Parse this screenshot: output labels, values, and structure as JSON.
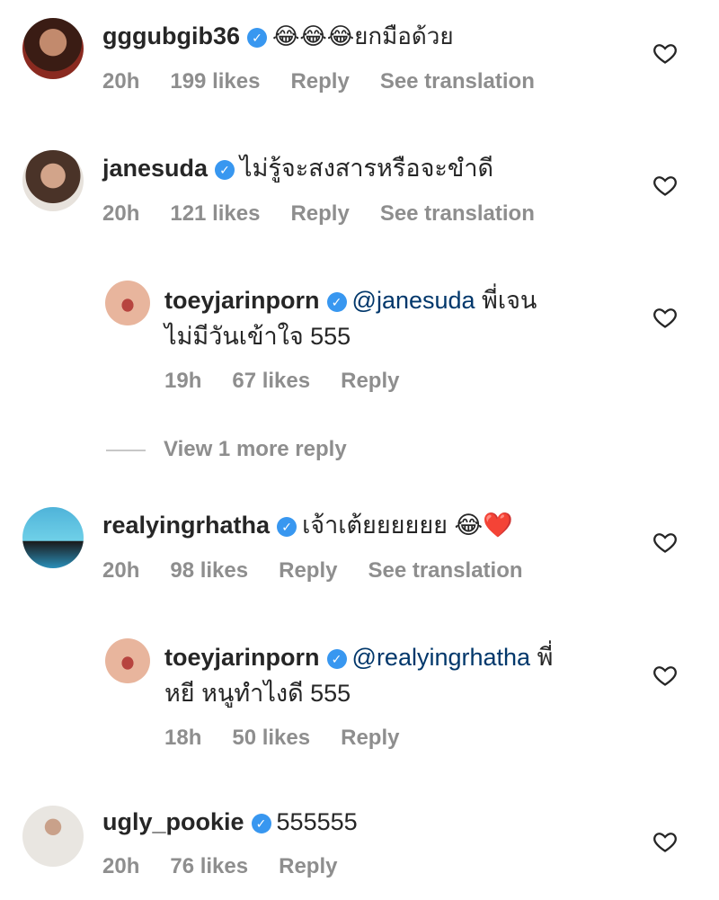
{
  "comments": [
    {
      "username": "gggubgib36",
      "text": "😂😂😂ยกมือด้วย",
      "time": "20h",
      "likes": "199 likes",
      "reply": "Reply",
      "translate": "See translation"
    },
    {
      "username": "janesuda",
      "text": "ไม่รู้จะสงสารหรือจะขำดี",
      "time": "20h",
      "likes": "121 likes",
      "reply": "Reply",
      "translate": "See translation"
    },
    {
      "username": "toeyjarinporn",
      "mention": "@janesuda",
      "text_line1": " พี่เจน",
      "text_line2": "ไม่มีวันเข้าใจ 555",
      "time": "19h",
      "likes": "67 likes",
      "reply": "Reply"
    },
    {
      "username": "realyingrhatha",
      "text": "เจ้าเต้ยยยยยย 😂❤️",
      "time": "20h",
      "likes": "98 likes",
      "reply": "Reply",
      "translate": "See translation"
    },
    {
      "username": "toeyjarinporn",
      "mention": "@realyingrhatha",
      "text_line1": " พี่",
      "text_line2": "หยี หนูทำไงดี 555",
      "time": "18h",
      "likes": "50 likes",
      "reply": "Reply"
    },
    {
      "username": "ugly_pookie",
      "text": "555555",
      "time": "20h",
      "likes": "76 likes",
      "reply": "Reply"
    }
  ],
  "view_more": "View 1 more reply",
  "icons": {
    "verified": "verified-badge-icon",
    "like": "heart-outline-icon"
  },
  "colors": {
    "verified": "#3897f0",
    "mention": "#00376b",
    "meta": "#8e8e8e"
  }
}
